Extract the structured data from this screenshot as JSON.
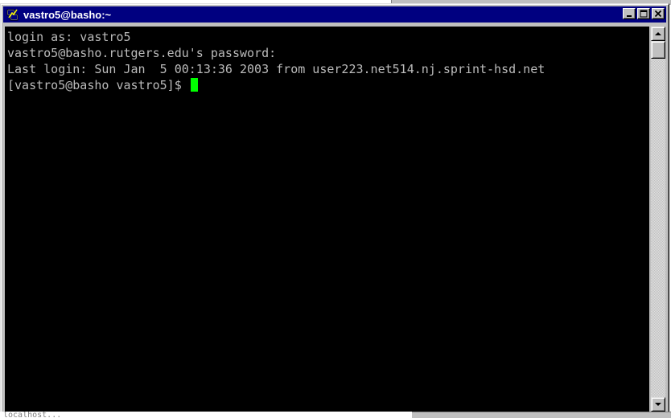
{
  "window": {
    "title": "vastro5@basho:~",
    "icon": "putty-terminal-icon",
    "buttons": {
      "minimize": "minimize-icon",
      "maximize": "maximize-icon",
      "close": "close-icon"
    }
  },
  "terminal": {
    "lines": [
      "login as: vastro5",
      "vastro5@basho.rutgers.edu's password:",
      "Last login: Sun Jan  5 00:13:36 2003 from user223.net514.nj.sprint-hsd.net"
    ],
    "prompt": "[vastro5@basho vastro5]$ ",
    "colors": {
      "background": "#000000",
      "foreground": "#bbbbbb",
      "cursor": "#00ff00"
    }
  },
  "desktop": {
    "partial_text": "localhost..."
  },
  "colors": {
    "titlebar": "#000080",
    "chrome": "#c0c0c0"
  }
}
